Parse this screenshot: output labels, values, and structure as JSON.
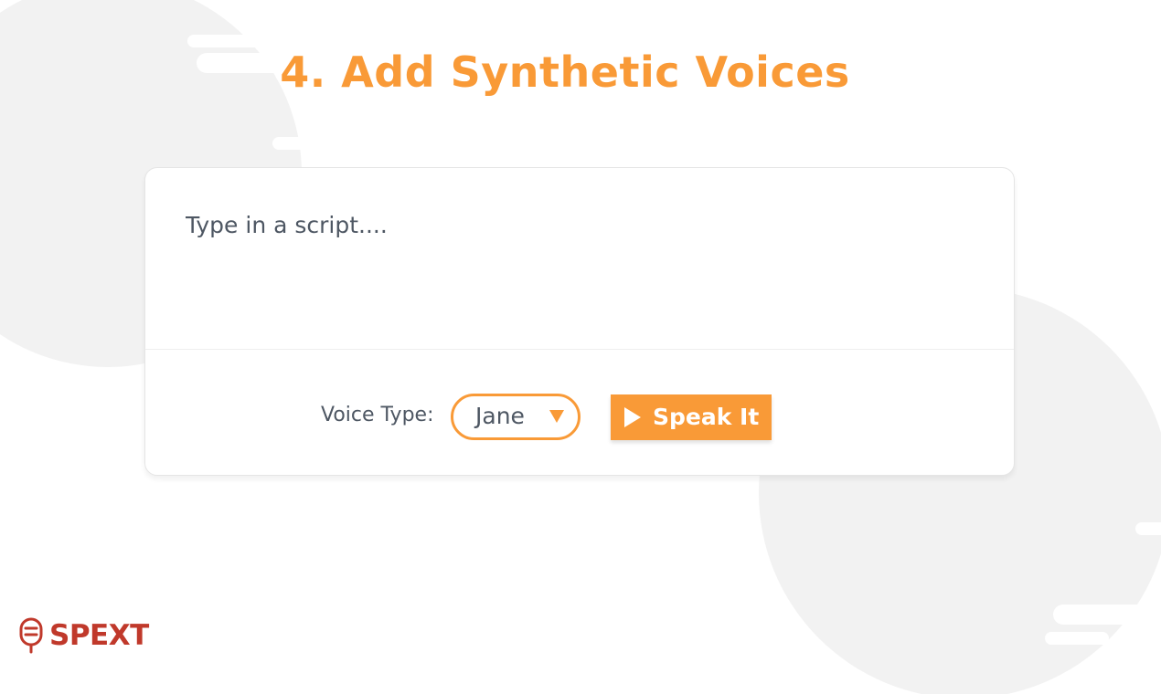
{
  "header": {
    "title": "4. Add Synthetic Voices"
  },
  "editor": {
    "script_placeholder": "Type in a script....",
    "script_value": "",
    "voice_type_label": "Voice Type:",
    "voice_selected": "Jane",
    "speak_button_label": "Speak It"
  },
  "brand": {
    "name": "SPEXT"
  },
  "icons": {
    "dropdown": "caret-down-icon",
    "play": "play-icon",
    "logo": "microphone-logo-icon"
  },
  "colors": {
    "accent": "#f99a37",
    "brand": "#c0392b",
    "text": "#4e5763",
    "decor": "#f2f2f2"
  }
}
